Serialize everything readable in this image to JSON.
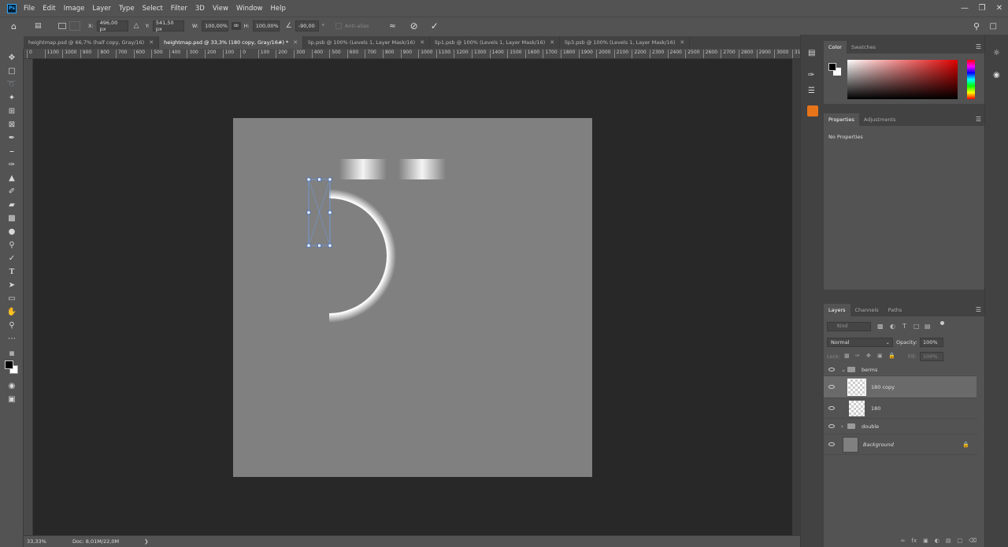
{
  "app": {
    "logo_text": "Ps"
  },
  "menu": [
    "File",
    "Edit",
    "Image",
    "Layer",
    "Type",
    "Select",
    "Filter",
    "3D",
    "View",
    "Window",
    "Help"
  ],
  "options": {
    "x_label": "X:",
    "x_value": "496,00 px",
    "y_label": "Y:",
    "y_value": "541,50 px",
    "w_label": "W:",
    "w_value": "100,00%",
    "h_label": "H:",
    "h_value": "100,00%",
    "angle_value": "-90,00",
    "degree": "°",
    "antialias_label": "Anti-alias"
  },
  "tabs": [
    {
      "label": "heightmap.psd @ 66,7% (half copy, Gray/16)"
    },
    {
      "label": "heightmap.psd @ 33,3% (180 copy, Gray/16#) *"
    },
    {
      "label": "lip.psb @ 100% (Levels 1, Layer Mask/16)"
    },
    {
      "label": "lip1.psb @ 100% (Levels 1, Layer Mask/16)"
    },
    {
      "label": "lip3.psb @ 100% (Levels 1, Layer Mask/16)"
    }
  ],
  "ruler_ticks": [
    "0",
    "1100",
    "1000",
    "900",
    "800",
    "700",
    "600",
    "500",
    "400",
    "300",
    "200",
    "100",
    "0",
    "100",
    "200",
    "300",
    "400",
    "500",
    "600",
    "700",
    "800",
    "900",
    "1000",
    "1100",
    "1200",
    "1300",
    "1400",
    "1500",
    "1600",
    "1700",
    "1800",
    "1900",
    "2000",
    "2100",
    "2200",
    "2300",
    "2400",
    "2500",
    "2600",
    "2700",
    "2800",
    "2900",
    "3000",
    "3100"
  ],
  "status": {
    "zoom": "33,33%",
    "doc": "Doc: 8,01M/22,0M"
  },
  "color_panel": {
    "tab_color": "Color",
    "tab_swatches": "Swatches"
  },
  "properties_panel": {
    "tab_properties": "Properties",
    "tab_adjustments": "Adjustments",
    "empty_text": "No Properties"
  },
  "layers_panel": {
    "tab_layers": "Layers",
    "tab_channels": "Channels",
    "tab_paths": "Paths",
    "kind_placeholder": "Kind",
    "blend_mode": "Normal",
    "opacity_label": "Opacity:",
    "opacity_value": "100%",
    "lock_label": "Lock:",
    "fill_label": "Fill:",
    "fill_value": "100%",
    "layers": [
      {
        "name": "berms"
      },
      {
        "name": "180 copy"
      },
      {
        "name": "180"
      },
      {
        "name": "double"
      },
      {
        "name": "Background"
      }
    ]
  },
  "colors": {
    "accent": "#31a8ff",
    "canvas_bg": "#282828",
    "doc_fill": "#808080",
    "transform_handles": "#5b8fd6"
  }
}
